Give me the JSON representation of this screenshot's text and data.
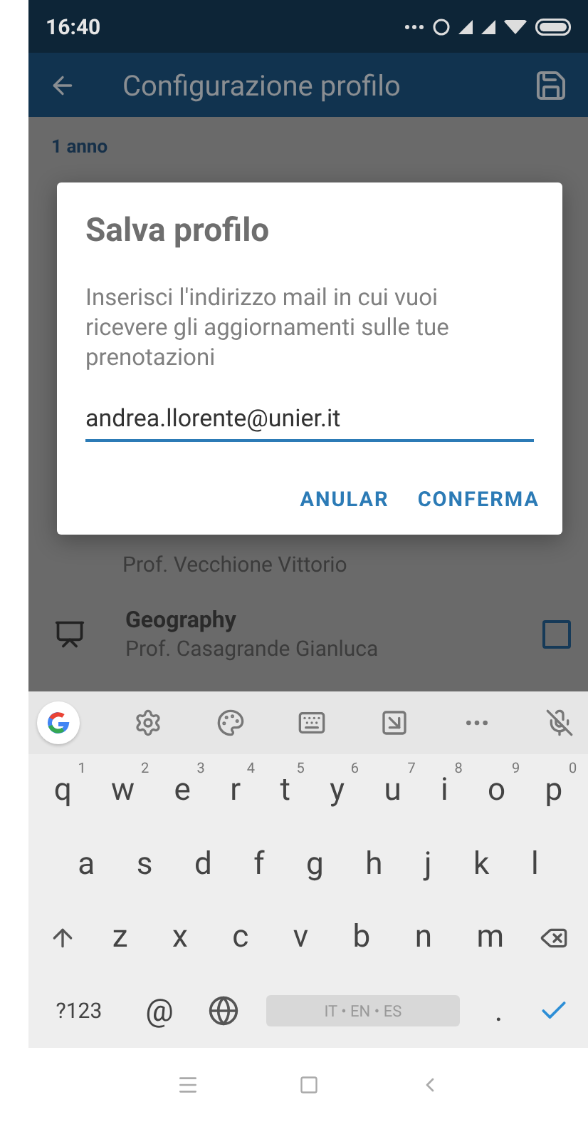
{
  "status_bar": {
    "time": "16:40"
  },
  "app_bar": {
    "title": "Configurazione profilo"
  },
  "list": {
    "section": "1 anno",
    "items": [
      {
        "kind": "partial",
        "subtitle": "Prof. Vecchione Vittorio"
      },
      {
        "kind": "course",
        "title": "Geography",
        "subtitle": "Prof. Casagrande Gianluca",
        "checked": false
      }
    ]
  },
  "dialog": {
    "title": "Salva profilo",
    "message": "Inserisci l'indirizzo mail in cui vuoi ricevere gli aggiornamenti sulle tue prenotazioni",
    "email": {
      "value": "andrea.llorente@unier.it",
      "focused": true
    },
    "buttons": [
      "ANULAR",
      "CONFERMA"
    ]
  },
  "keyboard": {
    "rows": [
      {
        "keys": [
          {
            "kind": "char",
            "label": "q",
            "hint": "1"
          },
          {
            "kind": "char",
            "label": "w",
            "hint": "2"
          },
          {
            "kind": "char",
            "label": "e",
            "hint": "3"
          },
          {
            "kind": "char",
            "label": "r",
            "hint": "4"
          },
          {
            "kind": "char",
            "label": "t",
            "hint": "5"
          },
          {
            "kind": "char",
            "label": "y",
            "hint": "6"
          },
          {
            "kind": "char",
            "label": "u",
            "hint": "7"
          },
          {
            "kind": "char",
            "label": "i",
            "hint": "8"
          },
          {
            "kind": "char",
            "label": "o",
            "hint": "9"
          },
          {
            "kind": "char",
            "label": "p",
            "hint": "0"
          }
        ]
      },
      {
        "keys": [
          {
            "kind": "char",
            "label": "a"
          },
          {
            "kind": "char",
            "label": "s"
          },
          {
            "kind": "char",
            "label": "d"
          },
          {
            "kind": "char",
            "label": "f"
          },
          {
            "kind": "char",
            "label": "g"
          },
          {
            "kind": "char",
            "label": "h"
          },
          {
            "kind": "char",
            "label": "j"
          },
          {
            "kind": "char",
            "label": "k"
          },
          {
            "kind": "char",
            "label": "l"
          }
        ]
      },
      {
        "keys": [
          {
            "kind": "shift"
          },
          {
            "kind": "char",
            "label": "z"
          },
          {
            "kind": "char",
            "label": "x"
          },
          {
            "kind": "char",
            "label": "c"
          },
          {
            "kind": "char",
            "label": "v"
          },
          {
            "kind": "char",
            "label": "b"
          },
          {
            "kind": "char",
            "label": "n"
          },
          {
            "kind": "char",
            "label": "m"
          },
          {
            "kind": "backspace"
          }
        ]
      },
      {
        "keys": [
          {
            "kind": "symbols",
            "label": "?123"
          },
          {
            "kind": "char",
            "label": "@"
          },
          {
            "kind": "globe"
          },
          {
            "kind": "space",
            "label": "IT • EN • ES"
          },
          {
            "kind": "char",
            "label": "."
          },
          {
            "kind": "enter"
          }
        ]
      }
    ]
  }
}
